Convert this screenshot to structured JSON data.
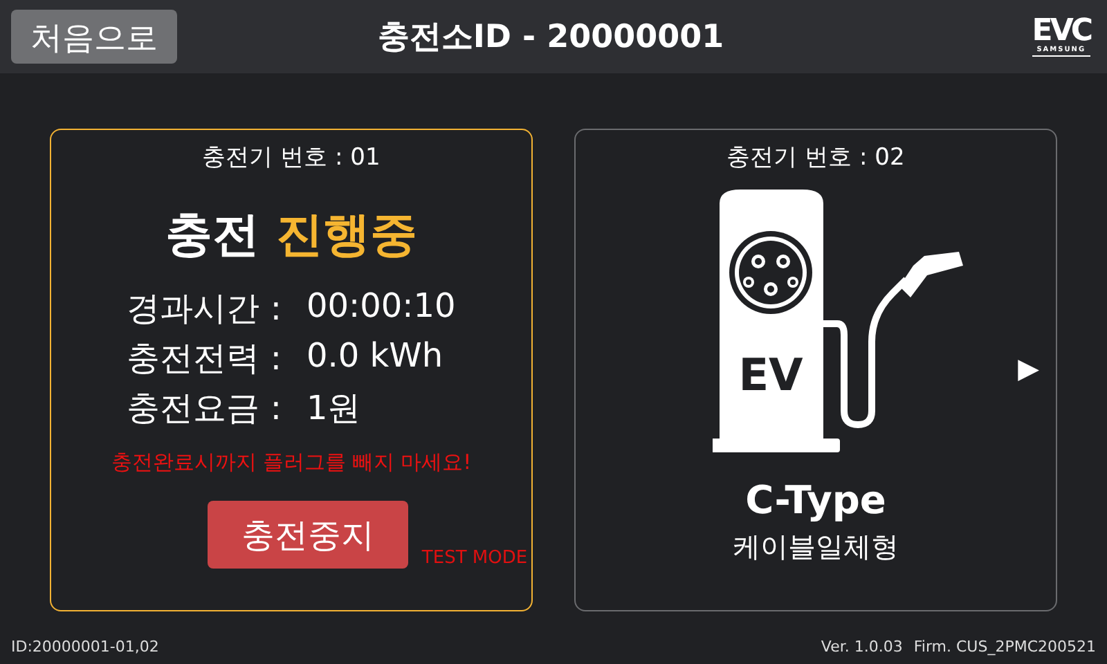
{
  "header": {
    "home_button": "처음으로",
    "title": "충전소ID - 20000001",
    "logo": {
      "main": "EVC",
      "sub": "SAMSUNG"
    }
  },
  "chargers": [
    {
      "kind": "charging",
      "selected": true,
      "number_label": "충전기 번호 : 01",
      "status": [
        "충전",
        "진행중"
      ],
      "rows": [
        {
          "label": "경과시간 :",
          "value": "00:00:10"
        },
        {
          "label": "충전전력 :",
          "value": "0.0 kWh"
        },
        {
          "label": "충전요금 :",
          "value": "1원"
        }
      ],
      "warning": "충전완료시까지 플러그를 빼지 마세요!",
      "stop_button": "충전중지",
      "mode": "TEST MODE"
    },
    {
      "kind": "idle",
      "selected": false,
      "number_label": "충전기 번호 : 02",
      "pump_text": "EV",
      "connector": "C-Type",
      "cable": "케이블일체형",
      "next": "▶"
    }
  ],
  "footer": {
    "id": "ID:20000001-01,02",
    "version": "Ver. 1.0.03",
    "firmware": "Firm. CUS_2PMC200521"
  }
}
